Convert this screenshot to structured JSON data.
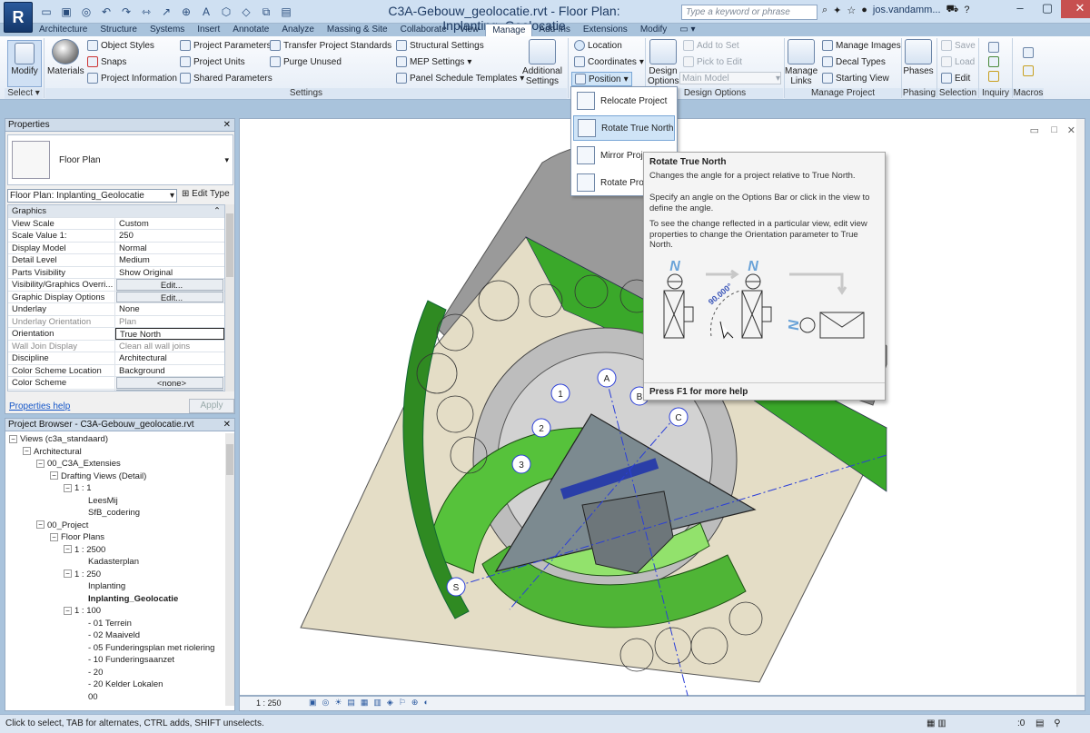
{
  "app": {
    "title": "C3A-Gebouw_geolocatie.rvt - Floor Plan: Inplanting_Geolocatie",
    "logo": "R",
    "search_placeholder": "Type a keyword or phrase",
    "user": "jos.vandamm..."
  },
  "tabs": [
    "Architecture",
    "Structure",
    "Systems",
    "Insert",
    "Annotate",
    "Analyze",
    "Massing & Site",
    "Collaborate",
    "View",
    "Manage",
    "Add-Ins",
    "Extensions",
    "Modify"
  ],
  "active_tab": "Manage",
  "ribbon": {
    "modify": "Modify",
    "materials": "Materials",
    "object_styles": "Object  Styles",
    "snaps": "Snaps",
    "project_information": "Project  Information",
    "project_parameters": "Project  Parameters",
    "project_units": "Project  Units",
    "shared_parameters": "Shared  Parameters",
    "transfer_project_standards": "Transfer  Project Standards",
    "purge_unused": "Purge  Unused",
    "structural_settings": "Structural  Settings",
    "mep_settings": "MEP  Settings",
    "panel_schedule_templates": "Panel Schedule  Templates",
    "additional_settings": "Additional Settings",
    "location": "Location",
    "coordinates": "Coordinates",
    "position": "Position",
    "design_options": "Design Options",
    "add_to_set": "Add to Set",
    "pick_to_edit": "Pick to Edit",
    "main_model": "Main Model",
    "manage_links": "Manage Links",
    "manage_images": "Manage  Images",
    "decal_types": "Decal  Types",
    "starting_view": "Starting  View",
    "phases": "Phases",
    "save": "Save",
    "load": "Load",
    "edit": "Edit",
    "panels": {
      "select": "Select",
      "settings": "Settings",
      "design_options": "Design Options",
      "manage_project": "Manage Project",
      "phasing": "Phasing",
      "selection": "Selection",
      "inquiry": "Inquiry",
      "macros": "Macros"
    }
  },
  "position_menu": {
    "items": [
      "Relocate Project",
      "Rotate True North",
      "Mirror Project",
      "Rotate Project"
    ]
  },
  "tooltip": {
    "title": "Rotate True North",
    "p1": "Changes the angle for a project relative to True North.",
    "p2": "Specify an angle on the Options Bar or click in the view to define the angle.",
    "p3": "To see the change reflected in a particular view, edit view properties to change the Orientation parameter to True North.",
    "angle": "90.000°",
    "north": "N",
    "footer": "Press F1 for more help"
  },
  "properties": {
    "header": "Properties",
    "type_name": "Floor Plan",
    "instance": "Floor Plan: Inplanting_Geolocatie",
    "edit_type": "Edit Type",
    "group": "Graphics",
    "rows": [
      {
        "k": "View Scale",
        "v": "Custom"
      },
      {
        "k": "Scale Value    1:",
        "v": "250"
      },
      {
        "k": "Display Model",
        "v": "Normal"
      },
      {
        "k": "Detail Level",
        "v": "Medium"
      },
      {
        "k": "Parts Visibility",
        "v": "Show Original"
      },
      {
        "k": "Visibility/Graphics Overri...",
        "v": "Edit..."
      },
      {
        "k": "Graphic Display Options",
        "v": "Edit..."
      },
      {
        "k": "Underlay",
        "v": "None"
      },
      {
        "k": "Underlay Orientation",
        "v": "Plan"
      },
      {
        "k": "Orientation",
        "v": "True North"
      },
      {
        "k": "Wall Join Display",
        "v": "Clean all wall joins"
      },
      {
        "k": "Discipline",
        "v": "Architectural"
      },
      {
        "k": "Color Scheme Location",
        "v": "Background"
      },
      {
        "k": "Color Scheme",
        "v": "<none>"
      },
      {
        "k": "System Color Schemes",
        "v": "Edit..."
      }
    ],
    "help": "Properties help",
    "apply": "Apply"
  },
  "browser": {
    "header": "Project Browser - C3A-Gebouw_geolocatie.rvt",
    "nodes": [
      {
        "t": "Views (c3a_standaard)",
        "d": 0,
        "ex": "-"
      },
      {
        "t": "Architectural",
        "d": 1,
        "ex": "-"
      },
      {
        "t": "00_C3A_Extensies",
        "d": 2,
        "ex": "-"
      },
      {
        "t": "Drafting Views (Detail)",
        "d": 3,
        "ex": "-"
      },
      {
        "t": "1 : 1",
        "d": 4,
        "ex": "-"
      },
      {
        "t": "LeesMij",
        "d": 5,
        "ex": ""
      },
      {
        "t": "SfB_codering",
        "d": 5,
        "ex": ""
      },
      {
        "t": "00_Project",
        "d": 2,
        "ex": "-"
      },
      {
        "t": "Floor Plans",
        "d": 3,
        "ex": "-"
      },
      {
        "t": "1 : 2500",
        "d": 4,
        "ex": "-"
      },
      {
        "t": "Kadasterplan",
        "d": 5,
        "ex": ""
      },
      {
        "t": "1 : 250",
        "d": 4,
        "ex": "-"
      },
      {
        "t": "Inplanting",
        "d": 5,
        "ex": ""
      },
      {
        "t": "Inplanting_Geolocatie",
        "d": 5,
        "ex": "",
        "bold": true
      },
      {
        "t": "1 : 100",
        "d": 4,
        "ex": "-"
      },
      {
        "t": "- 01 Terrein",
        "d": 5,
        "ex": ""
      },
      {
        "t": "- 02 Maaiveld",
        "d": 5,
        "ex": ""
      },
      {
        "t": "- 05 Funderingsplan met riolering",
        "d": 5,
        "ex": ""
      },
      {
        "t": "- 10 Funderingsaanzet",
        "d": 5,
        "ex": ""
      },
      {
        "t": "- 20",
        "d": 5,
        "ex": ""
      },
      {
        "t": "- 20 Kelder Lokalen",
        "d": 5,
        "ex": ""
      },
      {
        "t": "00",
        "d": 5,
        "ex": ""
      }
    ]
  },
  "view": {
    "scale": "1 : 250",
    "grid_labels": [
      "A",
      "B",
      "C",
      "1",
      "2",
      "3",
      "S"
    ]
  },
  "status": {
    "text": "Click to select, TAB for alternates, CTRL adds, SHIFT unselects.",
    "right": ":0"
  }
}
